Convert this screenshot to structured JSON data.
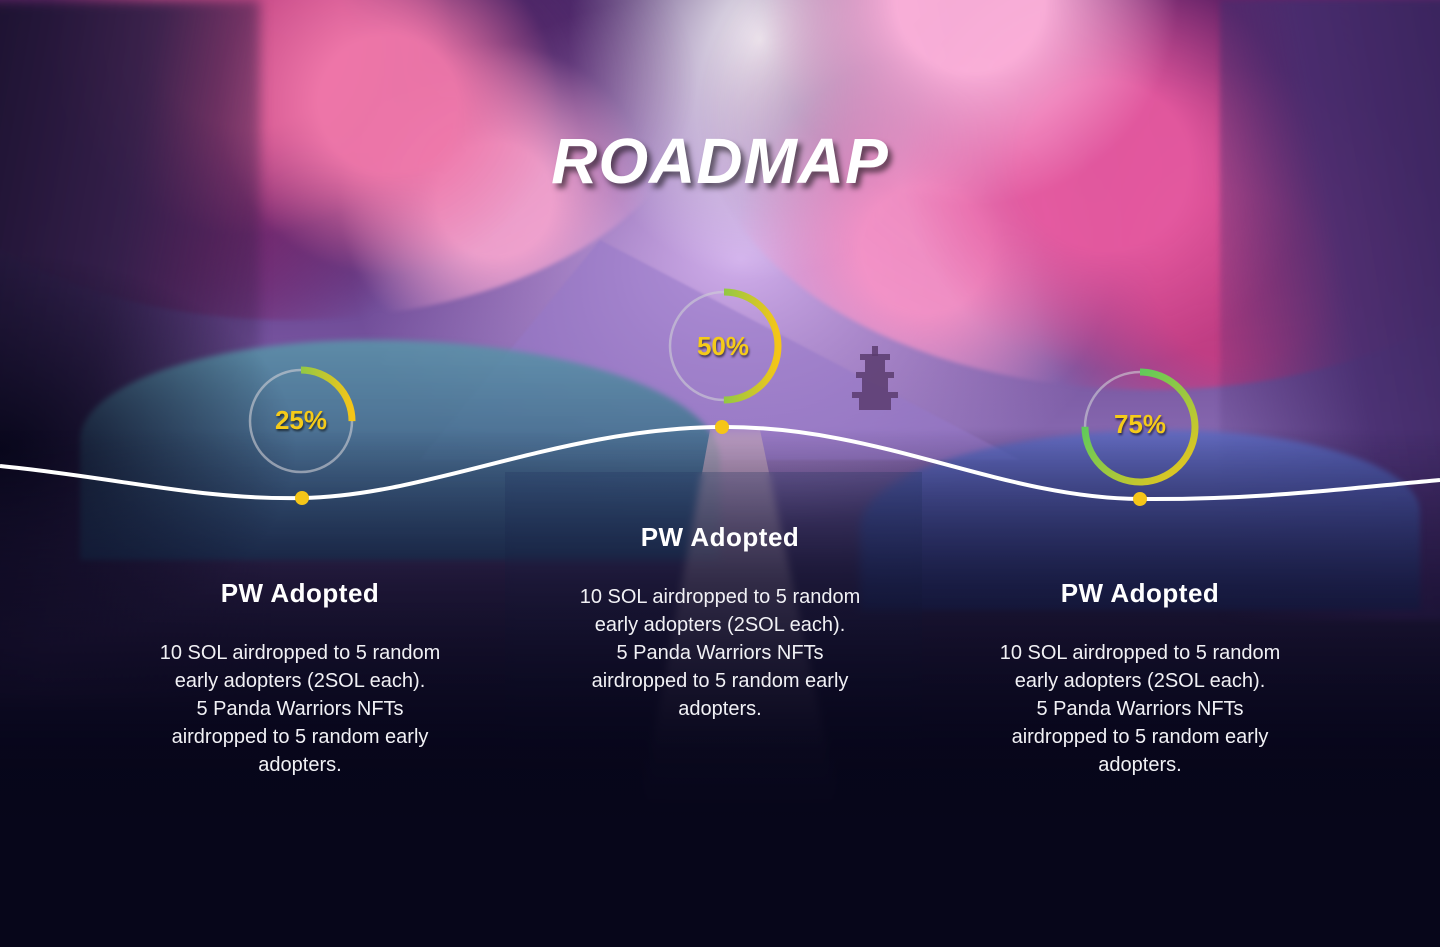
{
  "title": "ROADMAP",
  "milestones": [
    {
      "percent_label": "25%",
      "progress": 0.25,
      "heading": "PW Adopted",
      "description": "10 SOL airdropped to 5 random\nearly adopters (2SOL each).\n5 Panda Warriors NFTs\nairdropped to 5 random early\nadopters."
    },
    {
      "percent_label": "50%",
      "progress": 0.5,
      "heading": "PW Adopted",
      "description": "10 SOL airdropped to 5 random\nearly adopters (2SOL each).\n5 Panda Warriors NFTs\nairdropped to 5 random early\nadopters."
    },
    {
      "percent_label": "75%",
      "progress": 0.75,
      "heading": "PW Adopted",
      "description": "10 SOL airdropped to 5 random\nearly adopters (2SOL each).\n5 Panda Warriors NFTs\nairdropped to 5 random early\nadopters."
    }
  ],
  "colors": {
    "ring_track": "#cfcfd6",
    "ring_start": "#f5c518",
    "ring_end": "#2ecc71",
    "marker": "#f5c518",
    "timeline": "#ffffff",
    "background": "#07061a"
  }
}
